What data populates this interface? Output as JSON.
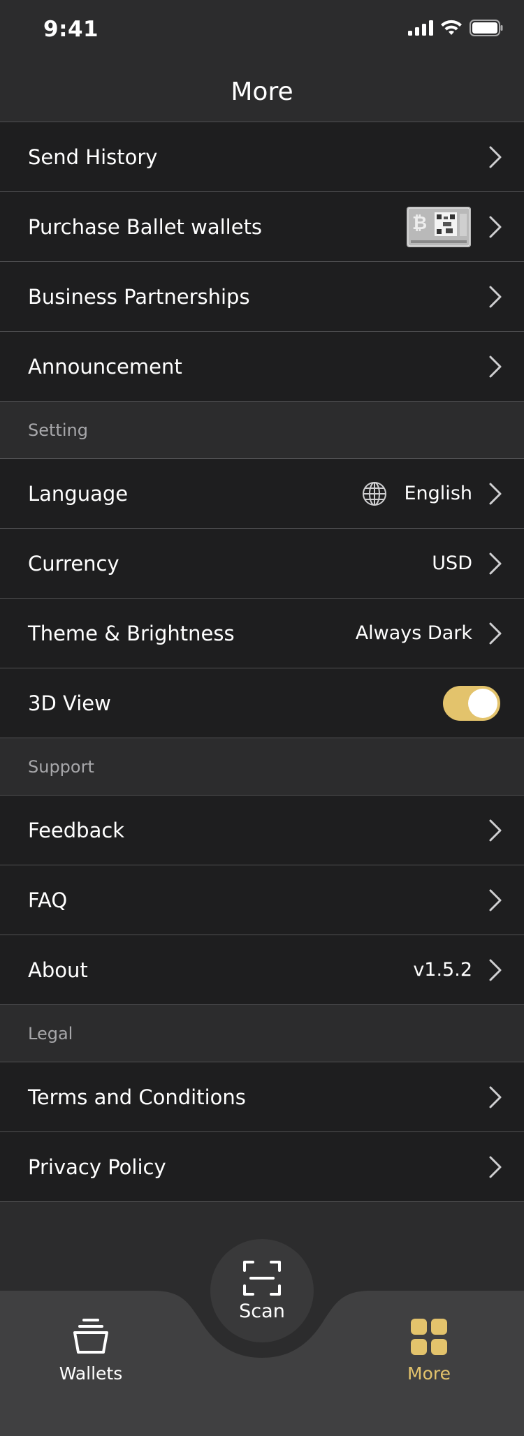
{
  "status_bar": {
    "time": "9:41",
    "icons": [
      "cellular-signal-icon",
      "wifi-icon",
      "battery-icon"
    ]
  },
  "nav": {
    "title": "More"
  },
  "group_main": [
    {
      "label": "Send History"
    },
    {
      "label": "Purchase Ballet wallets",
      "thumbnail": "ballet-wallet-card-image"
    },
    {
      "label": "Business Partnerships"
    },
    {
      "label": "Announcement"
    }
  ],
  "section_setting": {
    "header": "Setting",
    "items": [
      {
        "label": "Language",
        "value": "English",
        "icon": "globe-icon"
      },
      {
        "label": "Currency",
        "value": "USD"
      },
      {
        "label": "Theme & Brightness",
        "value": "Always Dark"
      },
      {
        "label": "3D View",
        "toggle_on": true
      }
    ]
  },
  "section_support": {
    "header": "Support",
    "items": [
      {
        "label": "Feedback"
      },
      {
        "label": "FAQ"
      },
      {
        "label": "About",
        "value": "v1.5.2"
      }
    ]
  },
  "section_legal": {
    "header": "Legal",
    "items": [
      {
        "label": "Terms and Conditions"
      },
      {
        "label": "Privacy Policy"
      }
    ]
  },
  "tab_bar": {
    "wallets_label": "Wallets",
    "scan_label": "Scan",
    "more_label": "More",
    "active_tab": "More"
  },
  "colors": {
    "background": "#2c2c2d",
    "row_background": "#1e1e1f",
    "accent": "#e3c36c",
    "tab_bar": "#404041",
    "divider": "#505052",
    "section_text": "#a7a7aa"
  }
}
